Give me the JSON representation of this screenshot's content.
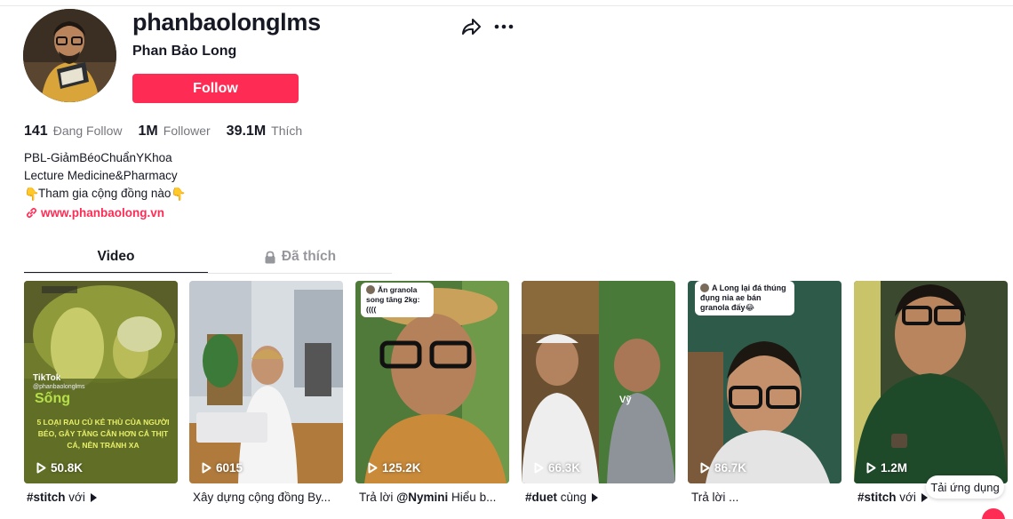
{
  "profile": {
    "username": "phanbaolonglms",
    "nickname": "Phan Bảo Long",
    "follow_label": "Follow"
  },
  "stats": [
    {
      "value": "141",
      "label": "Đang Follow"
    },
    {
      "value": "1M",
      "label": "Follower"
    },
    {
      "value": "39.1M",
      "label": "Thích"
    }
  ],
  "bio": {
    "line1": "PBL-GiảmBéoChuẩnYKhoa",
    "line2": "Lecture Medicine&Pharmacy",
    "line3": "Tham gia cộng đồng nào",
    "emoji": "👇",
    "link": "www.phanbaolong.vn"
  },
  "tabs": {
    "video": "Video",
    "liked": "Đã thích"
  },
  "videos": [
    {
      "views": "50.8K",
      "caption_tag": "#stitch",
      "caption_rest": " với"
    },
    {
      "views": "6015",
      "caption_tag": "",
      "caption_rest": "Xây dựng cộng đồng By..."
    },
    {
      "views": "125.2K",
      "caption_tag": "",
      "caption_pre": "Trả lời ",
      "caption_mention": "@Nymini",
      "caption_rest": " Hiểu b...",
      "overlay": "Ăn granola song tăng 2kg:(((("
    },
    {
      "views": "66.3K",
      "caption_tag": "#duet",
      "caption_rest": " cùng",
      "overlay_name": "Vỹ"
    },
    {
      "views": "86.7K",
      "caption_tag": "",
      "caption_rest": "Trả lời ...",
      "overlay": "A Long lại đá thúng đụng nia ae bán granola đấy😂"
    },
    {
      "views": "1.2M",
      "caption_tag": "#stitch",
      "caption_rest": " với"
    }
  ],
  "video1_overlay": {
    "brand": "TikTok",
    "handle": "@phanbaolonglms",
    "word": "Sống",
    "text": "5 LOẠI RAU CỦ KẺ THÙ CỦA NGƯỜI BÉO, GÂY TĂNG CÂN HƠN CẢ THỊT CÁ, NÊN TRÁNH XA"
  },
  "app_button": "Tải ứng dụng",
  "colors": {
    "accent": "#fe2c55",
    "text": "#161823"
  },
  "icons": [
    "share-icon",
    "more-icon",
    "link-icon",
    "lock-icon",
    "play-icon"
  ]
}
